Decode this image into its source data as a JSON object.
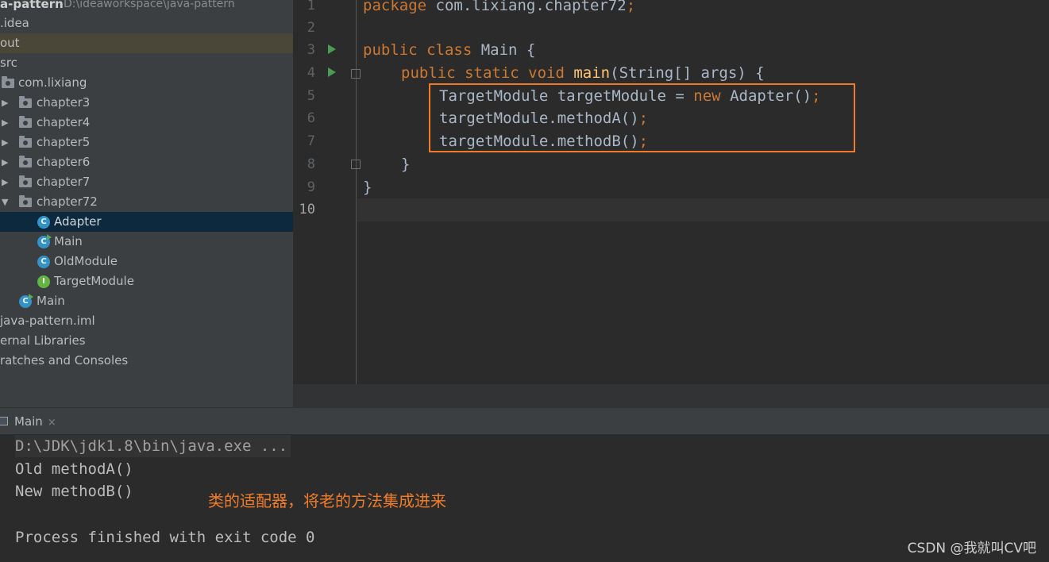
{
  "project_tree": {
    "root_name": "a-pattern",
    "root_path": "D:\\ideaworkspace\\java-pattern",
    "items": [
      {
        "label": ".idea"
      },
      {
        "label": "out"
      },
      {
        "label": "src"
      },
      {
        "label": "com.lixiang"
      },
      {
        "label": "chapter3"
      },
      {
        "label": "chapter4"
      },
      {
        "label": "chapter5"
      },
      {
        "label": "chapter6"
      },
      {
        "label": "chapter7"
      },
      {
        "label": "chapter72"
      },
      {
        "label": "Adapter"
      },
      {
        "label": "Main"
      },
      {
        "label": "OldModule"
      },
      {
        "label": "TargetModule"
      },
      {
        "label": "Main"
      },
      {
        "label": "java-pattern.iml"
      },
      {
        "label": "ernal Libraries"
      },
      {
        "label": "ratches and Consoles"
      }
    ]
  },
  "icons": {
    "class_letter": "C",
    "interface_letter": "I"
  },
  "editor": {
    "line_numbers": [
      "1",
      "2",
      "3",
      "4",
      "5",
      "6",
      "7",
      "8",
      "9",
      "10"
    ],
    "code": {
      "l1_kw": "package",
      "l1_rest": " com.lixiang.chapter72",
      "l1_semi": ";",
      "l3_kw": "public class",
      "l3_rest": " Main {",
      "l4_kw": "public static void",
      "l4_fn": "main",
      "l4_rest": "(String[] args) {",
      "l5_a": "TargetModule targetModule = ",
      "l5_kw": "new",
      "l5_b": " Adapter()",
      "l5_semi": ";",
      "l6_a": "targetModule.methodA()",
      "l6_semi": ";",
      "l7_a": "targetModule.methodB()",
      "l7_semi": ";",
      "l8": "}",
      "l9": "}"
    }
  },
  "run_panel": {
    "tab_label": "Main",
    "tab_close": "×",
    "console_lines": [
      "D:\\JDK\\jdk1.8\\bin\\java.exe ...",
      "Old methodA()",
      "New methodB()",
      "",
      "Process finished with exit code 0"
    ]
  },
  "annotation": "类的适配器，将老的方法集成进来",
  "watermark": "CSDN @我就叫CV吧",
  "colors": {
    "keyword": "#cc7832",
    "function": "#ffc66d",
    "highlight_border": "#f07c2a",
    "annotation": "#f07c2a"
  }
}
